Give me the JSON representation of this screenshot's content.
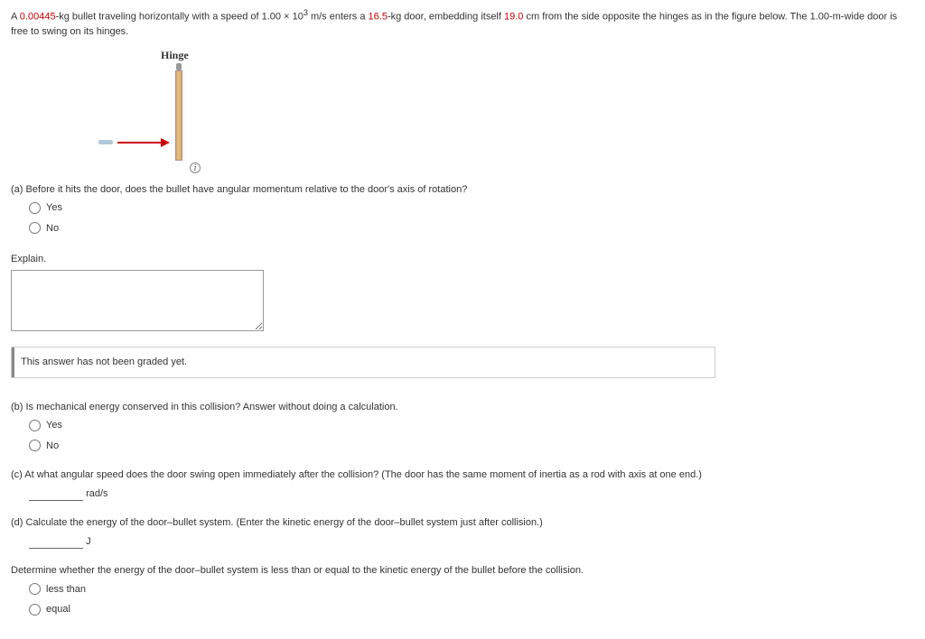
{
  "problem": {
    "prefix": "A ",
    "mass_bullet": "0.00445",
    "t1": "-kg bullet traveling horizontally with a speed of 1.00 × 10",
    "exp": "3",
    "t2": " m/s enters a ",
    "mass_door": "16.5",
    "t3": "-kg door, embedding itself ",
    "dist": "19.0",
    "t4": " cm from the side opposite the hinges as in the figure below. The 1.00-m-wide door is free to swing on its hinges."
  },
  "figure": {
    "hinge_label": "Hinge",
    "info": "i"
  },
  "qa": {
    "text": "(a) Before it hits the door, does the bullet have angular momentum relative to the door's axis of rotation?",
    "yes": "Yes",
    "no": "No"
  },
  "explain": {
    "label": "Explain.",
    "value": ""
  },
  "grading_msg": "This answer has not been graded yet.",
  "qb": {
    "text": "(b) Is mechanical energy conserved in this collision? Answer without doing a calculation.",
    "yes": "Yes",
    "no": "No"
  },
  "qc": {
    "text": "(c) At what angular speed does the door swing open immediately after the collision? (The door has the same moment of inertia as a rod with axis at one end.)",
    "unit": "rad/s"
  },
  "qd": {
    "text": "(d) Calculate the energy of the door–bullet system. (Enter the kinetic energy of the door–bullet system just after collision.)",
    "unit": "J"
  },
  "qe": {
    "text": "Determine whether the energy of the door–bullet system is less than or equal to the kinetic energy of the bullet before the collision.",
    "less": "less than",
    "equal": "equal"
  }
}
